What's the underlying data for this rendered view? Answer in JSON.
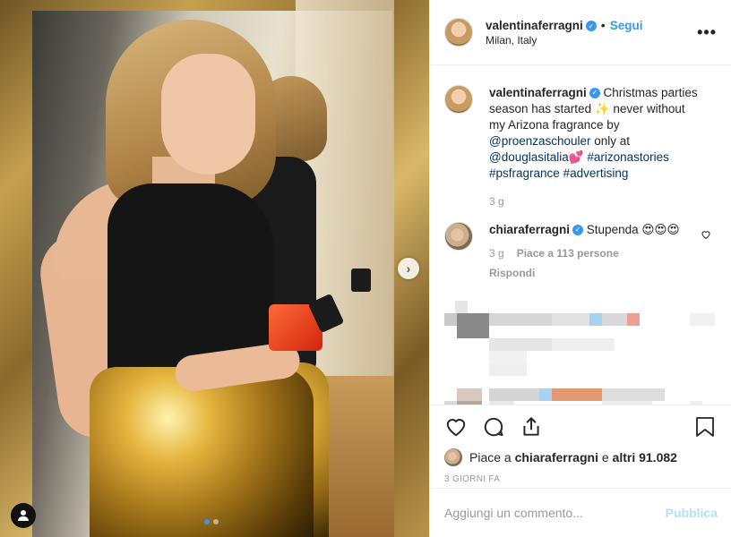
{
  "post_image": {
    "alt_hidden": "",
    "carousel_dots": 2,
    "active_dot": 0
  },
  "header": {
    "username": "valentinaferragni",
    "verified": true,
    "separator": "•",
    "follow_label": "Segui",
    "location": "Milan, Italy",
    "more_icon": "more-horizontal-icon"
  },
  "caption": {
    "username": "valentinaferragni",
    "text_1": " Christmas parties season has started ",
    "emoji_1": "✨",
    "text_2": " never without my Arizona fragrance by ",
    "mention_1": "@proenzaschouler",
    "text_3": " only at ",
    "mention_2": "@douglasitalia",
    "emoji_2": "💕",
    "text_4": " ",
    "hashtag_1": "#arizonastories",
    "text_5": " ",
    "hashtag_2": "#psfragrance",
    "text_6": " ",
    "hashtag_3": "#advertising",
    "time": "3 g"
  },
  "comment": {
    "username": "chiaraferragni",
    "verified": true,
    "text": " Stupenda ",
    "emoji": "😍😍😍",
    "time": "3 g",
    "likes": "Piace a 113 persone",
    "reply_label": "Rispondi"
  },
  "actions": {
    "like_icon": "heart-icon",
    "comment_icon": "comment-icon",
    "share_icon": "share-icon",
    "save_icon": "bookmark-icon"
  },
  "likes": {
    "prefix": "Piace a ",
    "user": "chiaraferragni",
    "middle": " e ",
    "others": "altri 91.082"
  },
  "timestamp": "3 GIORNI FA",
  "comment_box": {
    "placeholder": "Aggiungi un commento...",
    "publish_label": "Pubblica"
  },
  "colors": {
    "accent": "#3897f0",
    "publish_disabled": "#b2dffc",
    "muted": "#999999",
    "border": "#efefef"
  }
}
